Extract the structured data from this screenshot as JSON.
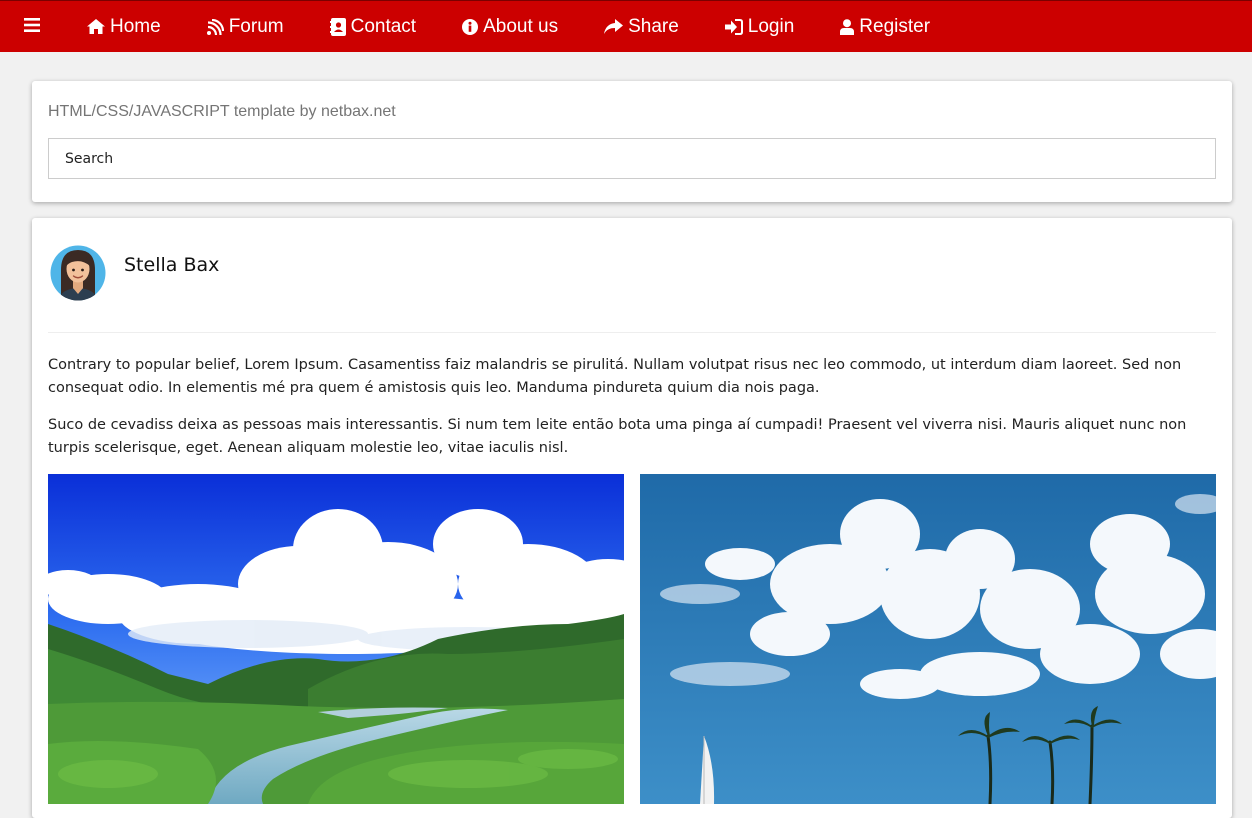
{
  "nav": {
    "items": [
      {
        "label": "Home",
        "icon": "home-icon"
      },
      {
        "label": "Forum",
        "icon": "feed-icon"
      },
      {
        "label": "Contact",
        "icon": "contact-book-icon"
      },
      {
        "label": "About us",
        "icon": "info-icon"
      },
      {
        "label": "Share",
        "icon": "share-icon"
      },
      {
        "label": "Login",
        "icon": "sign-in-icon"
      },
      {
        "label": "Register",
        "icon": "user-icon"
      }
    ],
    "menu_icon": "hamburger-menu-icon",
    "bg_color": "#cc0000"
  },
  "header": {
    "tagline": "HTML/CSS/JAVASCRIPT template by netbax.net",
    "search_placeholder": "Search"
  },
  "post": {
    "author": "Stella Bax",
    "paragraphs": [
      "Contrary to popular belief, Lorem Ipsum. Casamentiss faiz malandris se pirulitá. Nullam volutpat risus nec leo commodo, ut interdum diam laoreet. Sed non consequat odio. In elementis mé pra quem é amistosis quis leo. Manduma pindureta quium dia nois paga.",
      "Suco de cevadiss deixa as pessoas mais interessantis. Si num tem leite então bota uma pinga aí cumpadi! Praesent vel viverra nisi. Mauris aliquet nunc non turpis scelerisque, eget. Aenean aliquam molestie leo, vitae iaculis nisl."
    ],
    "images": [
      "river-valley-landscape",
      "tropical-beach-sky"
    ]
  }
}
